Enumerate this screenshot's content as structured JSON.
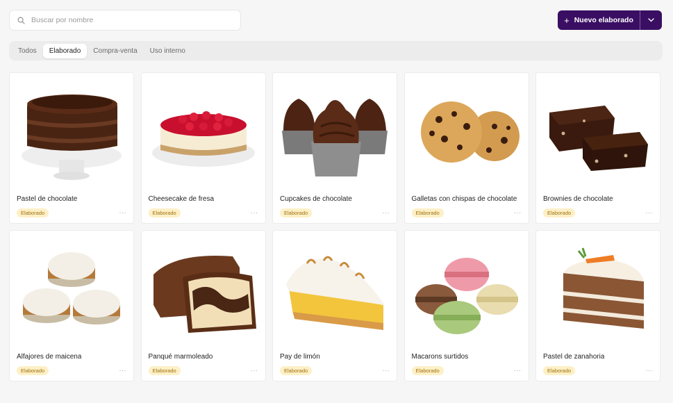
{
  "search": {
    "placeholder": "Buscar por nombre",
    "icon": "search-icon"
  },
  "new_button": {
    "label": "Nuevo elaborado",
    "plus_glyph": "+",
    "color": "#3a0f63"
  },
  "tabs": [
    {
      "label": "Todos",
      "active": false
    },
    {
      "label": "Elaborado",
      "active": true
    },
    {
      "label": "Compra-venta",
      "active": false
    },
    {
      "label": "Uso interno",
      "active": false
    }
  ],
  "products": [
    {
      "name": "Pastel de chocolate",
      "badge": "Elaborado",
      "image": "chocolate-cake-image"
    },
    {
      "name": "Cheesecake de fresa",
      "badge": "Elaborado",
      "image": "cheesecake-image"
    },
    {
      "name": "Cupcakes de chocolate",
      "badge": "Elaborado",
      "image": "cupcakes-image"
    },
    {
      "name": "Galletas con chispas de chocolate",
      "badge": "Elaborado",
      "image": "cookies-image"
    },
    {
      "name": "Brownies de chocolate",
      "badge": "Elaborado",
      "image": "brownies-image"
    },
    {
      "name": "Alfajores de maicena",
      "badge": "Elaborado",
      "image": "alfajores-image"
    },
    {
      "name": "Panqué marmoleado",
      "badge": "Elaborado",
      "image": "marble-loaf-image"
    },
    {
      "name": "Pay de limón",
      "badge": "Elaborado",
      "image": "lemon-pie-image"
    },
    {
      "name": "Macarons surtidos",
      "badge": "Elaborado",
      "image": "macarons-image"
    },
    {
      "name": "Pastel de zanahoria",
      "badge": "Elaborado",
      "image": "carrot-cake-image"
    }
  ],
  "more_glyph": "···",
  "colors": {
    "badge_bg": "#fdf0c6",
    "badge_text": "#a07010",
    "page_bg": "#f6f6f6"
  }
}
